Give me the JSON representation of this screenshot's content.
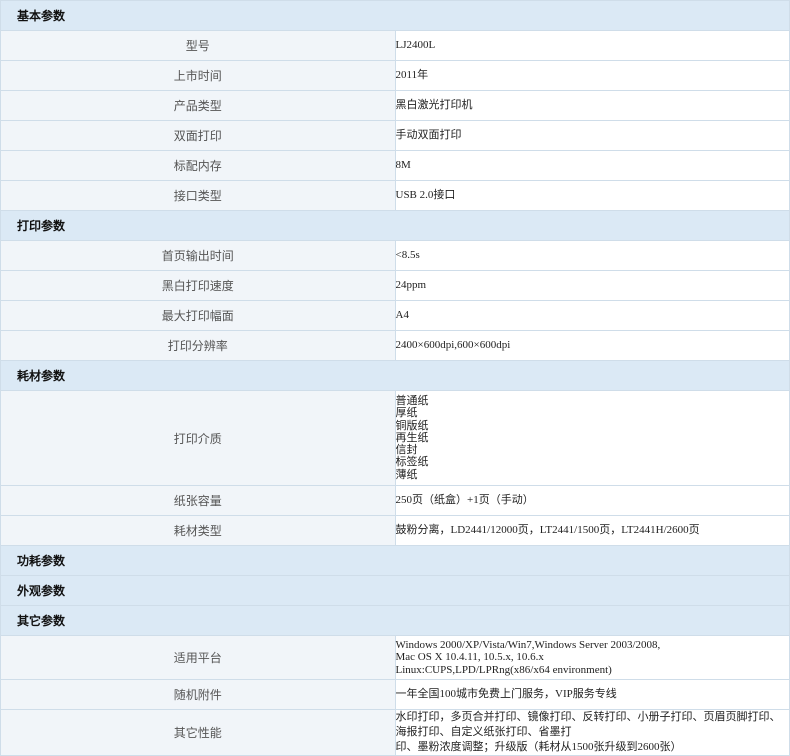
{
  "sections": {
    "basic": {
      "title": "基本参数",
      "rows": [
        {
          "label": "型号",
          "value": "LJ2400L"
        },
        {
          "label": "上市时间",
          "value": "2011年"
        },
        {
          "label": "产品类型",
          "value": "黑白激光打印机"
        },
        {
          "label": "双面打印",
          "value": "手动双面打印"
        },
        {
          "label": "标配内存",
          "value": "8M"
        },
        {
          "label": "接口类型",
          "value": "USB 2.0接口"
        }
      ]
    },
    "print": {
      "title": "打印参数",
      "rows": [
        {
          "label": "首页输出时间",
          "value": "<8.5s"
        },
        {
          "label": "黑白打印速度",
          "value": "24ppm"
        },
        {
          "label": "最大打印幅面",
          "value": "A4"
        },
        {
          "label": "打印分辨率",
          "value": "2400×600dpi,600×600dpi"
        }
      ]
    },
    "consumables": {
      "title": "耗材参数",
      "media_label": "打印介质",
      "media": [
        "普通纸",
        "厚纸",
        "铜版纸",
        "再生纸",
        "信封",
        "标签纸",
        "薄纸"
      ],
      "rows": [
        {
          "label": "纸张容量",
          "value": "250页（纸盒）+1页（手动）"
        },
        {
          "label": "耗材类型",
          "value": "鼓粉分离，LD2441/12000页，LT2441/1500页，LT2441H/2600页"
        }
      ]
    },
    "power": {
      "title": "功耗参数"
    },
    "appearance": {
      "title": "外观参数"
    },
    "other": {
      "title": "其它参数",
      "platform_label": "适用平台",
      "platform_lines": [
        "Windows 2000/XP/Vista/Win7,Windows Server 2003/2008,",
        "Mac OS X 10.4.11, 10.5.x, 10.6.x",
        "Linux:CUPS,LPD/LPRng(x86/x64 environment)"
      ],
      "accessories_label": "随机附件",
      "accessories_value": "一年全国100城市免费上门服务，VIP服务专线",
      "features_label": "其它性能",
      "features_lines": [
        "水印打印，多页合并打印、镜像打印、反转打印、小册子打印、页眉页脚打印、海报打印、自定义纸张打印、省墨打",
        "印、墨粉浓度调整；升级版（耗材从1500张升级到2600张）"
      ]
    }
  }
}
